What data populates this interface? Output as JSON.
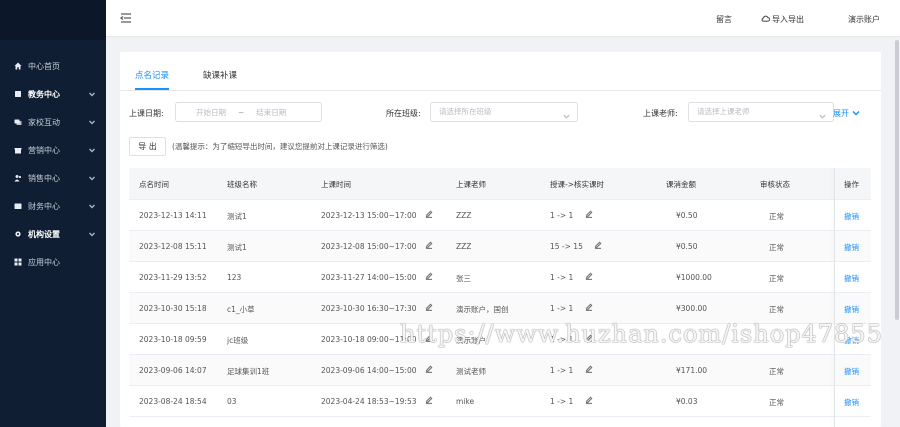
{
  "topbar": {
    "messages_label": "留言",
    "import_export_label": "导入导出",
    "account_label": "演示账户"
  },
  "sidebar": {
    "items": [
      {
        "label": "中心首页",
        "icon": "home-icon",
        "bold": false,
        "chevron": false
      },
      {
        "label": "教务中心",
        "icon": "book-icon",
        "bold": true,
        "chevron": true
      },
      {
        "label": "家校互动",
        "icon": "chat-icon",
        "bold": false,
        "chevron": true
      },
      {
        "label": "营销中心",
        "icon": "gift-icon",
        "bold": false,
        "chevron": true
      },
      {
        "label": "销售中心",
        "icon": "users-icon",
        "bold": false,
        "chevron": true
      },
      {
        "label": "财务中心",
        "icon": "wallet-icon",
        "bold": false,
        "chevron": true
      },
      {
        "label": "机构设置",
        "icon": "gear-icon",
        "bold": true,
        "chevron": true
      },
      {
        "label": "应用中心",
        "icon": "grid-icon",
        "bold": false,
        "chevron": false
      }
    ]
  },
  "tabs": [
    {
      "label": "点名记录",
      "active": true
    },
    {
      "label": "缺课补课",
      "active": false
    }
  ],
  "filters": {
    "date_label": "上课日期:",
    "date_start_placeholder": "开始日期",
    "date_sep": "~",
    "date_end_placeholder": "结束日期",
    "class_label": "所在班级:",
    "class_placeholder": "请选择所在班级",
    "teacher_label": "上课老师:",
    "teacher_placeholder": "请选择上课老师",
    "expand_label": "展开"
  },
  "actions": {
    "export_label": "导 出",
    "tip": "(温馨提示：为了缩短导出时间，建议您提前对上课记录进行筛选)"
  },
  "table": {
    "headers": [
      "点名时间",
      "班级名称",
      "上课时间",
      "上课老师",
      "授课->核实课时",
      "课消金额",
      "审核状态",
      "操作"
    ],
    "rows": [
      {
        "roll_time": "2023-12-13 14:11",
        "class_name": "测试1",
        "lesson_time": "2023-12-13 15:00~17:00",
        "teacher": "ZZZ",
        "hours": "1 -> 1",
        "amount": "¥0.50",
        "status": "正常",
        "op": "撤销"
      },
      {
        "roll_time": "2023-12-08 15:11",
        "class_name": "测试1",
        "lesson_time": "2023-12-08 15:00~17:00",
        "teacher": "ZZZ",
        "hours": "15 -> 15",
        "amount": "¥0.50",
        "status": "正常",
        "op": "撤销"
      },
      {
        "roll_time": "2023-11-29 13:52",
        "class_name": "123",
        "lesson_time": "2023-11-27 14:00~15:00",
        "teacher": "张三",
        "hours": "1 -> 1",
        "amount": "¥1000.00",
        "status": "正常",
        "op": "撤销"
      },
      {
        "roll_time": "2023-10-30 15:18",
        "class_name": "c1_小草",
        "lesson_time": "2023-10-30 16:30~17:30",
        "teacher": "演示账户，国创",
        "hours": "1 -> 1",
        "amount": "¥300.00",
        "status": "正常",
        "op": "撤销"
      },
      {
        "roll_time": "2023-10-18 09:59",
        "class_name": "jc班级",
        "lesson_time": "2023-10-18 09:00~11:00",
        "teacher": "演示账户",
        "hours": "1 -> 1",
        "amount": "",
        "status": "",
        "op": "撤销"
      },
      {
        "roll_time": "2023-09-06 14:07",
        "class_name": "足球集训1班",
        "lesson_time": "2023-09-06 14:00~15:00",
        "teacher": "测试老师",
        "hours": "1 -> 1",
        "amount": "¥171.00",
        "status": "正常",
        "op": "撤销"
      },
      {
        "roll_time": "2023-08-24 18:54",
        "class_name": "03",
        "lesson_time": "2023-04-24 18:53~19:53",
        "teacher": "mike",
        "hours": "1 -> 1",
        "amount": "¥0.03",
        "status": "正常",
        "op": "撤销"
      }
    ]
  },
  "watermark": "https://www.huzhan.com/ishop47855",
  "colors": {
    "sidebar_bg": "#0f1e33",
    "accent": "#1890ff"
  }
}
